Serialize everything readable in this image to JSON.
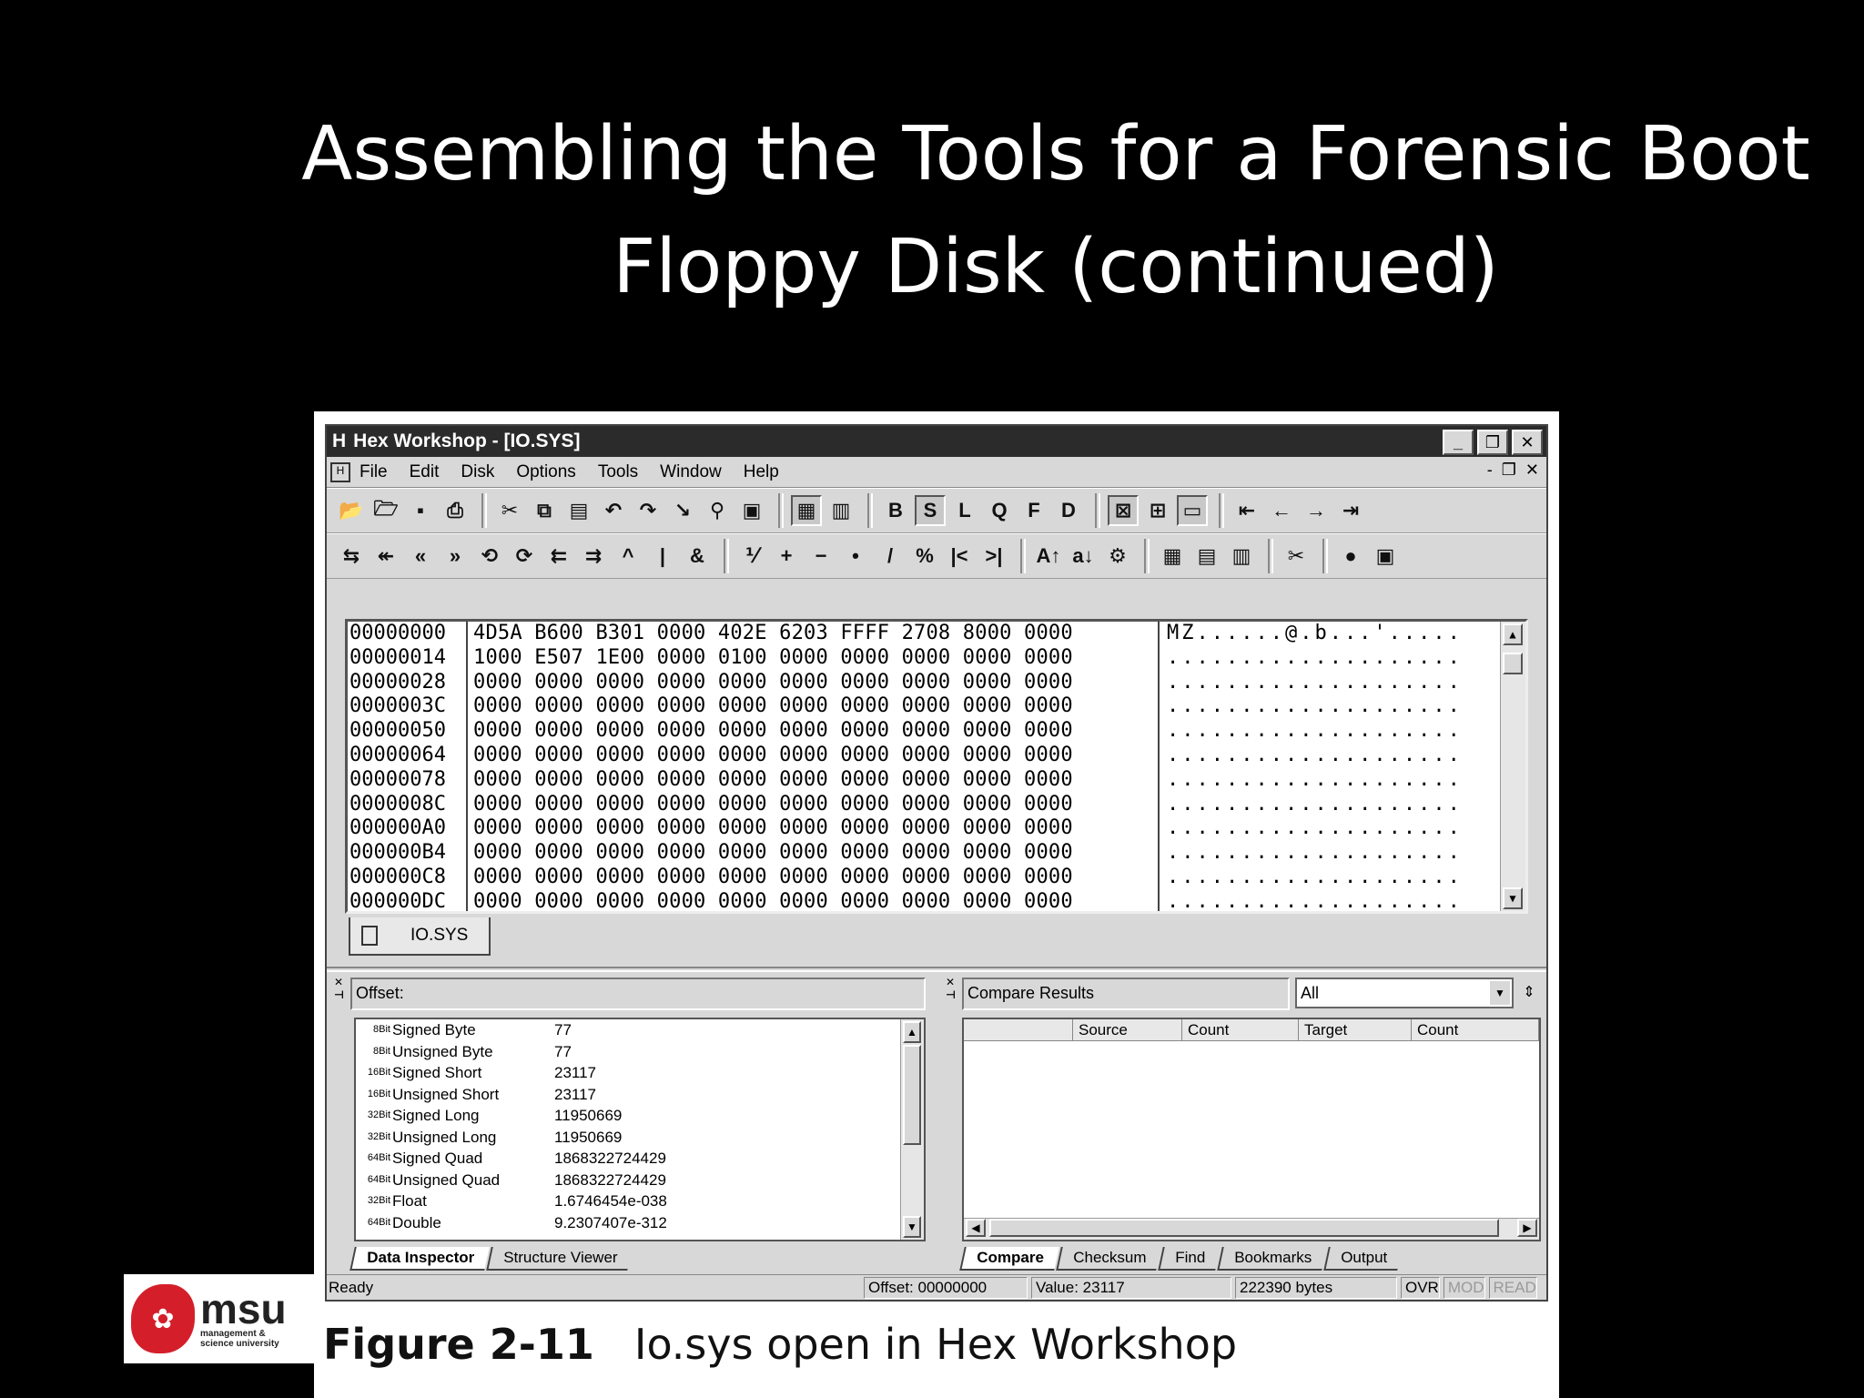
{
  "slide": {
    "title": "Assembling the Tools for a Forensic Boot Floppy Disk (continued)"
  },
  "window": {
    "title": "Hex Workshop - [IO.SYS]",
    "app_icon": "H",
    "buttons": [
      "_",
      "❐",
      "✕"
    ]
  },
  "menubar": {
    "items": [
      "File",
      "Edit",
      "Disk",
      "Options",
      "Tools",
      "Window",
      "Help"
    ],
    "mdi_buttons": [
      "-",
      "❐",
      "✕"
    ]
  },
  "toolbar1": {
    "icons": [
      "open-folder-icon",
      "open-icon",
      "save-icon",
      "print-icon",
      "cut-icon",
      "copy-icon",
      "paste-icon",
      "undo-icon",
      "redo-icon",
      "goto-icon",
      "find-icon",
      "properties-icon",
      "hex-view-icon",
      "text-view-icon",
      "byte-b-icon",
      "short-s-icon",
      "long-l-icon",
      "quad-q-icon",
      "float-f-icon",
      "double-d-icon",
      "compare-icon",
      "add-icon",
      "window-icon",
      "first-icon",
      "back-icon",
      "forward-icon",
      "last-icon"
    ],
    "labels": {
      "b": "B",
      "s": "S",
      "l": "L",
      "q": "Q",
      "f": "F",
      "d": "D"
    }
  },
  "toolbar2": {
    "glyphs": [
      "⇆",
      "↞",
      "«",
      "»",
      "⟲",
      "⟳",
      "⇇",
      "⇉",
      "^",
      "|",
      "&",
      "⅟",
      "+",
      "−",
      "•",
      "/",
      "%",
      "|<",
      ">|",
      "A↑",
      "a↓",
      "⚙",
      "▦",
      "▤",
      "▥",
      "✂",
      "●",
      "▣"
    ]
  },
  "hex": {
    "rows": [
      {
        "offset": "00000000",
        "data": "4D5A B600 B301 0000 402E 6203 FFFF 2708 8000 0000",
        "ascii": "MZ......@.b...'....."
      },
      {
        "offset": "00000014",
        "data": "1000 E507 1E00 0000 0100 0000 0000 0000 0000 0000",
        "ascii": "...................."
      },
      {
        "offset": "00000028",
        "data": "0000 0000 0000 0000 0000 0000 0000 0000 0000 0000",
        "ascii": "...................."
      },
      {
        "offset": "0000003C",
        "data": "0000 0000 0000 0000 0000 0000 0000 0000 0000 0000",
        "ascii": "...................."
      },
      {
        "offset": "00000050",
        "data": "0000 0000 0000 0000 0000 0000 0000 0000 0000 0000",
        "ascii": "...................."
      },
      {
        "offset": "00000064",
        "data": "0000 0000 0000 0000 0000 0000 0000 0000 0000 0000",
        "ascii": "...................."
      },
      {
        "offset": "00000078",
        "data": "0000 0000 0000 0000 0000 0000 0000 0000 0000 0000",
        "ascii": "...................."
      },
      {
        "offset": "0000008C",
        "data": "0000 0000 0000 0000 0000 0000 0000 0000 0000 0000",
        "ascii": "...................."
      },
      {
        "offset": "000000A0",
        "data": "0000 0000 0000 0000 0000 0000 0000 0000 0000 0000",
        "ascii": "...................."
      },
      {
        "offset": "000000B4",
        "data": "0000 0000 0000 0000 0000 0000 0000 0000 0000 0000",
        "ascii": "...................."
      },
      {
        "offset": "000000C8",
        "data": "0000 0000 0000 0000 0000 0000 0000 0000 0000 0000",
        "ascii": "...................."
      },
      {
        "offset": "000000DC",
        "data": "0000 0000 0000 0000 0000 0000 0000 0000 0000 0000",
        "ascii": "...................."
      }
    ]
  },
  "doc_tab": {
    "label": "IO.SYS"
  },
  "inspector": {
    "header": "Offset:",
    "rows": [
      {
        "bits": "8Bit",
        "type": "Signed Byte",
        "value": "77"
      },
      {
        "bits": "8Bit",
        "type": "Unsigned Byte",
        "value": "77"
      },
      {
        "bits": "16Bit",
        "type": "Signed Short",
        "value": "23117"
      },
      {
        "bits": "16Bit",
        "type": "Unsigned Short",
        "value": "23117"
      },
      {
        "bits": "32Bit",
        "type": "Signed Long",
        "value": "11950669"
      },
      {
        "bits": "32Bit",
        "type": "Unsigned Long",
        "value": "11950669"
      },
      {
        "bits": "64Bit",
        "type": "Signed Quad",
        "value": "1868322724429"
      },
      {
        "bits": "64Bit",
        "type": "Unsigned Quad",
        "value": "1868322724429"
      },
      {
        "bits": "32Bit",
        "type": "Float",
        "value": "1.6746454e-038"
      },
      {
        "bits": "64Bit",
        "type": "Double",
        "value": "9.2307407e-312"
      }
    ],
    "tabs": [
      "Data Inspector",
      "Structure Viewer"
    ]
  },
  "compare": {
    "header": "Compare Results",
    "filter": "All",
    "columns": [
      "",
      "Source",
      "Count",
      "Target",
      "Count"
    ],
    "tabs": [
      "Compare",
      "Checksum",
      "Find",
      "Bookmarks",
      "Output"
    ]
  },
  "statusbar": {
    "ready": "Ready",
    "offset": "Offset: 00000000",
    "value": "Value: 23117",
    "size": "222390 bytes",
    "ovr": "OVR",
    "mod": "MOD",
    "read": "READ"
  },
  "caption": {
    "figure": "Figure 2-11",
    "text": "Io.sys open in Hex Workshop"
  },
  "logo": {
    "word": "msu",
    "sub1": "management &",
    "sub2": "science university"
  },
  "colors": {
    "slide_bg": "#000000",
    "window_bg": "#d8d8d8",
    "titlebar": "#2b2b2b",
    "logo_red": "#d41f2b"
  }
}
